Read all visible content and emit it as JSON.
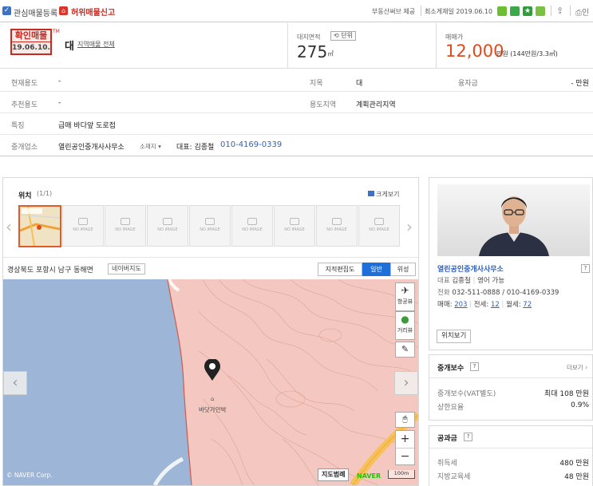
{
  "topbar": {
    "favorite_label": "관심매물등록",
    "false_report_label": "허위매물신고",
    "info_source": "부동산써브 제공",
    "confirm_date": "최소게재일 2019.06.10"
  },
  "summary": {
    "stamp_top": "확인매물",
    "stamp_date": "19.06.10.",
    "stamp_tm": "TM",
    "type": "대",
    "region_link": "지역매물 전체",
    "area_label": "대지면적",
    "unit_button": "단위",
    "area_value": "275",
    "area_unit": "㎡",
    "price_label": "매매가",
    "price_value": "12,000",
    "price_unit": "만원 (144만원/3.3㎡)"
  },
  "info_rows": [
    {
      "k1": "현재용도",
      "v1": "-",
      "k2": "지목",
      "v2": "대",
      "k3": "융자금",
      "v3": "- 만원"
    },
    {
      "k1": "추천용도",
      "v1": "-",
      "k2": "용도지역",
      "v2": "계획관리지역"
    },
    {
      "k1": "특징",
      "v1": "급매 바다앞 도로접"
    },
    {
      "k1": "중개업소",
      "v1": "열린공인중개사사무소",
      "v1b": "소재지",
      "v1c": "대표: 김종철",
      "phone": "010-4169-0339"
    }
  ],
  "photos": {
    "title": "위치",
    "count": "(1/1)",
    "enlarge": "크게보기",
    "no_image": "NO IMAGE"
  },
  "map": {
    "address": "경상북도 포항시 남구 동해면",
    "naver_map_button": "네이버지도",
    "type_cadastral": "지적편집도",
    "type_normal": "일반",
    "type_satellite": "위성",
    "ctrl_aerial": "항공뷰",
    "ctrl_street": "거리뷰",
    "ctrl_plus": "+",
    "ctrl_minus": "−",
    "place_label": "바닷가민박",
    "copyright": "© NAVER Corp.",
    "legend_button": "지도범례",
    "naver_logo": "NAVER",
    "scale": "100m"
  },
  "agent": {
    "name": "열린공인중개사사무소",
    "rep_label": "대표",
    "rep_name": "김종철",
    "lang": "영어 가능",
    "phone_label": "전화",
    "phone": "032-511-0888 / 010-4169-0339",
    "sale_label": "매매:",
    "sale_count": "203",
    "jeonse_label": "전세:",
    "jeonse_count": "12",
    "monthly_label": "월세:",
    "monthly_count": "72",
    "location_button": "위치보기"
  },
  "fee": {
    "title": "중개보수",
    "more": "더보기",
    "row1_k": "중개보수(VAT별도)",
    "row1_v": "최대 108 만원",
    "row2_k": "상한요율",
    "row2_v": "0.9%"
  },
  "tax": {
    "title": "공과금",
    "row1_k": "취득세",
    "row1_v": "480 만원",
    "row2_k": "지방교육세",
    "row2_v": "48 만원"
  },
  "colors": {
    "accent_blue": "#3461b8",
    "price_orange": "#e14b1c",
    "stamp_red": "#c9291f",
    "map_sea": "#9db5d6",
    "map_land": "#f4c8c0"
  }
}
